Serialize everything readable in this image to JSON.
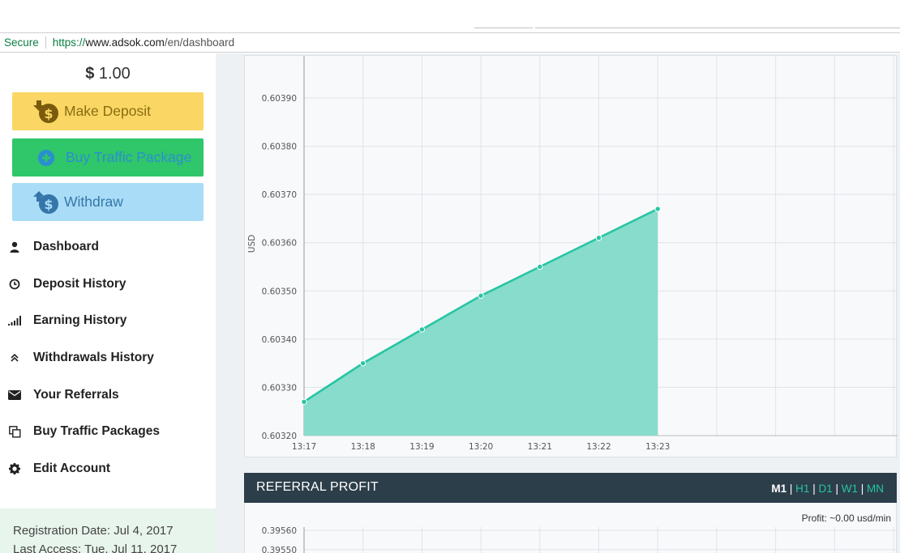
{
  "browser": {
    "secure_label": "Secure",
    "url_scheme": "https://",
    "url_host": "www.adsok.com",
    "url_path": "/en/dashboard"
  },
  "sidebar": {
    "balance_currency": "$",
    "balance_value": "1.00",
    "buttons": {
      "deposit": "Make Deposit",
      "traffic": "Buy Traffic Package",
      "withdraw": "Withdraw"
    },
    "nav": [
      {
        "label": "Dashboard",
        "icon": "user-icon"
      },
      {
        "label": "Deposit History",
        "icon": "clock-icon"
      },
      {
        "label": "Earning History",
        "icon": "signal-bars-icon"
      },
      {
        "label": "Withdrawals History",
        "icon": "double-chevron-up-icon"
      },
      {
        "label": "Your Referrals",
        "icon": "envelope-icon"
      },
      {
        "label": "Buy Traffic Packages",
        "icon": "copy-icon"
      },
      {
        "label": "Edit Account",
        "icon": "gear-icon"
      }
    ],
    "registration": "Registration Date: Jul 4, 2017",
    "last_access": "Last Access: Tue, Jul 11, 2017"
  },
  "referral": {
    "title": "REFERRAL PROFIT",
    "periods": [
      "M1",
      "H1",
      "D1",
      "W1",
      "MN"
    ],
    "active_period": "M1",
    "profit_label": "Profit: ~0.00 usd/min"
  },
  "colors": {
    "accent": "#26c5a3",
    "area_fill": "#88dccb",
    "header_bg": "#2c3e4a",
    "deposit_btn": "#fad764",
    "traffic_btn": "#30c66a",
    "withdraw_btn": "#a9dcf6"
  },
  "chart_data": [
    {
      "type": "area",
      "ylabel": "USD",
      "categories": [
        "13:17",
        "13:18",
        "13:19",
        "13:20",
        "13:21",
        "13:22",
        "13:23"
      ],
      "values": [
        0.60327,
        0.60335,
        0.60342,
        0.60349,
        0.60355,
        0.60361,
        0.60367
      ],
      "y_ticks": [
        "0.60320",
        "0.60330",
        "0.60340",
        "0.60350",
        "0.60360",
        "0.60370",
        "0.60380",
        "0.60390"
      ],
      "ylim": [
        0.6032,
        0.6039
      ],
      "grid": true
    },
    {
      "type": "area",
      "y_ticks": [
        "0.39560",
        "0.39550"
      ],
      "grid": true
    }
  ]
}
